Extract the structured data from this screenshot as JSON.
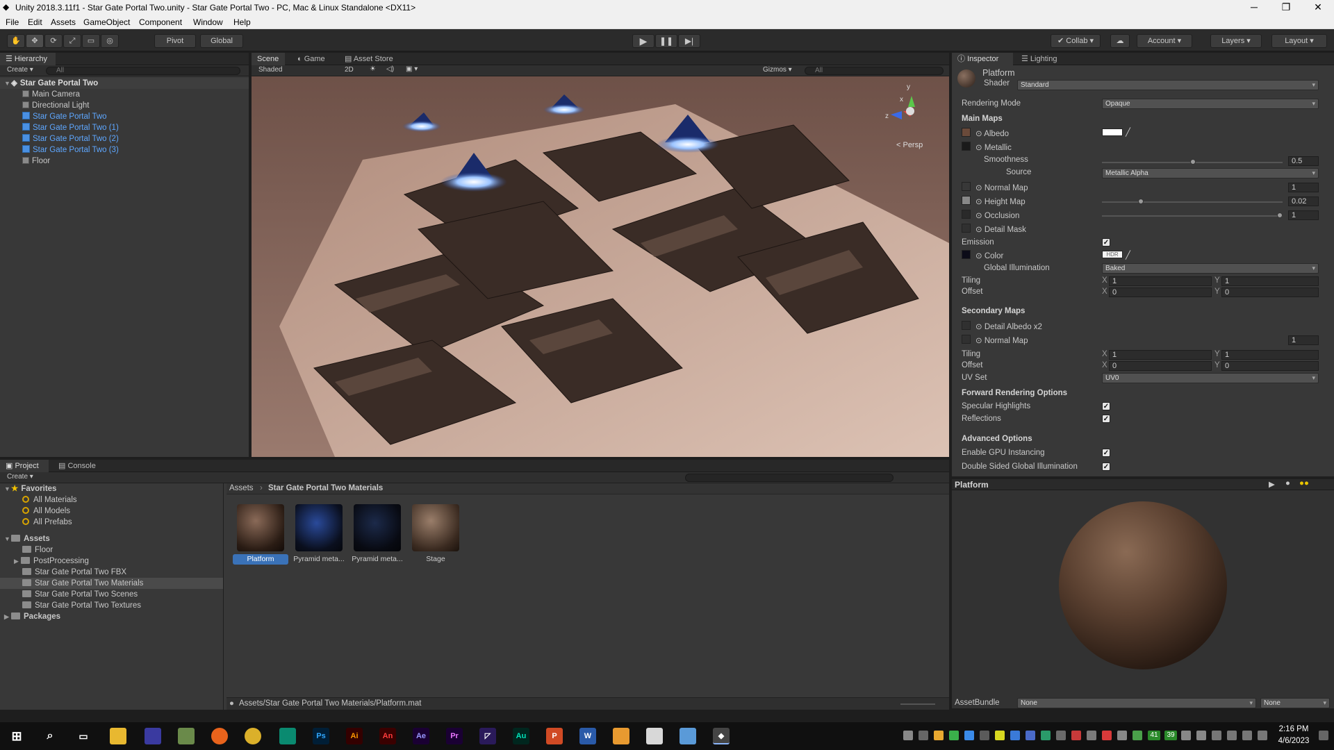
{
  "window": {
    "title": "Unity 2018.3.11f1 - Star Gate Portal Two.unity - Star Gate Portal Two - PC, Mac & Linux Standalone <DX11>"
  },
  "menu": [
    "File",
    "Edit",
    "Assets",
    "GameObject",
    "Component",
    "Window",
    "Help"
  ],
  "toolbar": {
    "pivot": "Pivot",
    "global": "Global",
    "collab": "Collab",
    "account": "Account",
    "layers": "Layers",
    "layout": "Layout"
  },
  "hierarchy": {
    "tab": "Hierarchy",
    "create": "Create",
    "search_placeholder": "All",
    "scene_name": "Star Gate Portal Two",
    "items": [
      {
        "label": "Main Camera",
        "prefab": false
      },
      {
        "label": "Directional Light",
        "prefab": false
      },
      {
        "label": "Star Gate Portal Two",
        "prefab": true
      },
      {
        "label": "Star Gate Portal Two (1)",
        "prefab": true
      },
      {
        "label": "Star Gate Portal Two (2)",
        "prefab": true
      },
      {
        "label": "Star Gate Portal Two (3)",
        "prefab": true
      },
      {
        "label": "Floor",
        "prefab": false
      }
    ]
  },
  "scene": {
    "tabs": [
      "Scene",
      "Game",
      "Asset Store"
    ],
    "shading": "Shaded",
    "mode2d": "2D",
    "gizmos": "Gizmos",
    "search_placeholder": "All",
    "persp": "< Persp",
    "gizmo_axes": {
      "x": "x",
      "y": "y",
      "z": "z"
    }
  },
  "inspector": {
    "tabs": [
      "Inspector",
      "Lighting"
    ],
    "material_name": "Platform",
    "shader_label": "Shader",
    "shader_value": "Standard",
    "rendering_mode_label": "Rendering Mode",
    "rendering_mode_value": "Opaque",
    "main_maps": "Main Maps",
    "albedo": "Albedo",
    "metallic": "Metallic",
    "smoothness": "Smoothness",
    "smoothness_value": "0.5",
    "source": "Source",
    "source_value": "Metallic Alpha",
    "normal_map": "Normal Map",
    "normal_map_value": "1",
    "height_map": "Height Map",
    "height_map_value": "0.02",
    "occlusion": "Occlusion",
    "occlusion_value": "1",
    "detail_mask": "Detail Mask",
    "emission": "Emission",
    "color": "Color",
    "hdr": "HDR",
    "global_illumination": "Global Illumination",
    "gi_value": "Baked",
    "tiling": "Tiling",
    "offset": "Offset",
    "x": "X",
    "y": "Y",
    "tiling_x": "1",
    "tiling_y": "1",
    "offset_x": "0",
    "offset_y": "0",
    "secondary_maps": "Secondary Maps",
    "detail_albedo": "Detail Albedo x2",
    "sec_normal_map": "Normal Map",
    "sec_normal_value": "1",
    "sec_tiling_x": "1",
    "sec_tiling_y": "1",
    "sec_offset_x": "0",
    "sec_offset_y": "0",
    "uv_set": "UV Set",
    "uv_set_value": "UV0",
    "forward_rendering": "Forward Rendering Options",
    "specular_highlights": "Specular Highlights",
    "reflections": "Reflections",
    "advanced_options": "Advanced Options",
    "gpu_instancing": "Enable GPU Instancing",
    "double_sided_gi": "Double Sided Global Illumination",
    "preview_title": "Platform",
    "assetbundle_label": "AssetBundle",
    "assetbundle_value": "None",
    "assetbundle_variant": "None",
    "colors": {
      "normal_swatch": "#7a7aff",
      "albedo_white": "#ffffff"
    }
  },
  "project": {
    "tabs": [
      "Project",
      "Console"
    ],
    "create": "Create",
    "favorites": "Favorites",
    "favorite_items": [
      "All Materials",
      "All Models",
      "All Prefabs"
    ],
    "assets": "Assets",
    "asset_folders": [
      "Floor",
      "PostProcessing",
      "Star Gate Portal Two FBX",
      "Star Gate Portal Two Materials",
      "Star Gate Portal Two Scenes",
      "Star Gate Portal Two Textures"
    ],
    "packages": "Packages",
    "breadcrumb_root": "Assets",
    "breadcrumb_current": "Star Gate Portal Two Materials",
    "thumbnails": [
      "Platform",
      "Pyramid meta...",
      "Pyramid meta...",
      "Stage"
    ],
    "status_path": "Assets/Star Gate Portal Two Materials/Platform.mat"
  },
  "taskbar": {
    "time": "2:16 PM",
    "date": "4/6/2023",
    "apps": [
      "Ps",
      "Ai",
      "An",
      "Ae",
      "Pr",
      "Au"
    ],
    "tray_numbers": [
      "41",
      "39"
    ]
  }
}
